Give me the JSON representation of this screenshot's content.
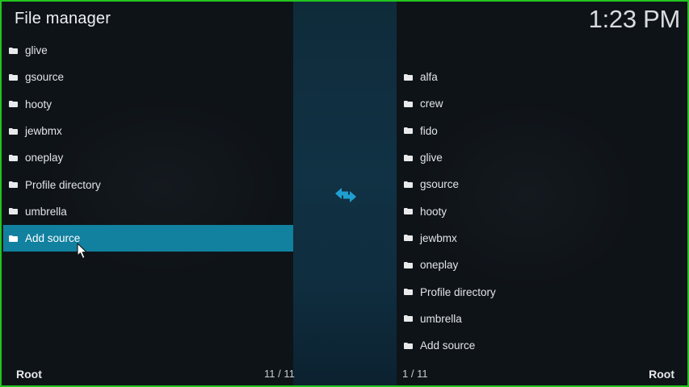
{
  "header": {
    "title": "File manager",
    "clock": "1:23 PM"
  },
  "left_list": {
    "items": [
      {
        "label": "glive"
      },
      {
        "label": "gsource"
      },
      {
        "label": "hooty"
      },
      {
        "label": "jewbmx"
      },
      {
        "label": "oneplay"
      },
      {
        "label": "Profile directory"
      },
      {
        "label": "umbrella"
      },
      {
        "label": "Add source",
        "selected": true
      }
    ],
    "footer_path": "Root",
    "footer_count": "11 / 11"
  },
  "right_list": {
    "items": [
      {
        "label": "alfa"
      },
      {
        "label": "crew"
      },
      {
        "label": "fido"
      },
      {
        "label": "glive"
      },
      {
        "label": "gsource"
      },
      {
        "label": "hooty"
      },
      {
        "label": "jewbmx"
      },
      {
        "label": "oneplay"
      },
      {
        "label": "Profile directory"
      },
      {
        "label": "umbrella"
      },
      {
        "label": "Add source"
      }
    ],
    "footer_path": "Root",
    "footer_count": "1 / 11"
  },
  "icons": {
    "item_icon": "folder-icon",
    "center_icon": "swap-arrows-icon",
    "pointer": "mouse-cursor-icon"
  },
  "colors": {
    "selection": "#12809f",
    "accent_arrows": "#1f9fd0",
    "frame_border": "#22c51f",
    "center_strip": "#103244"
  }
}
